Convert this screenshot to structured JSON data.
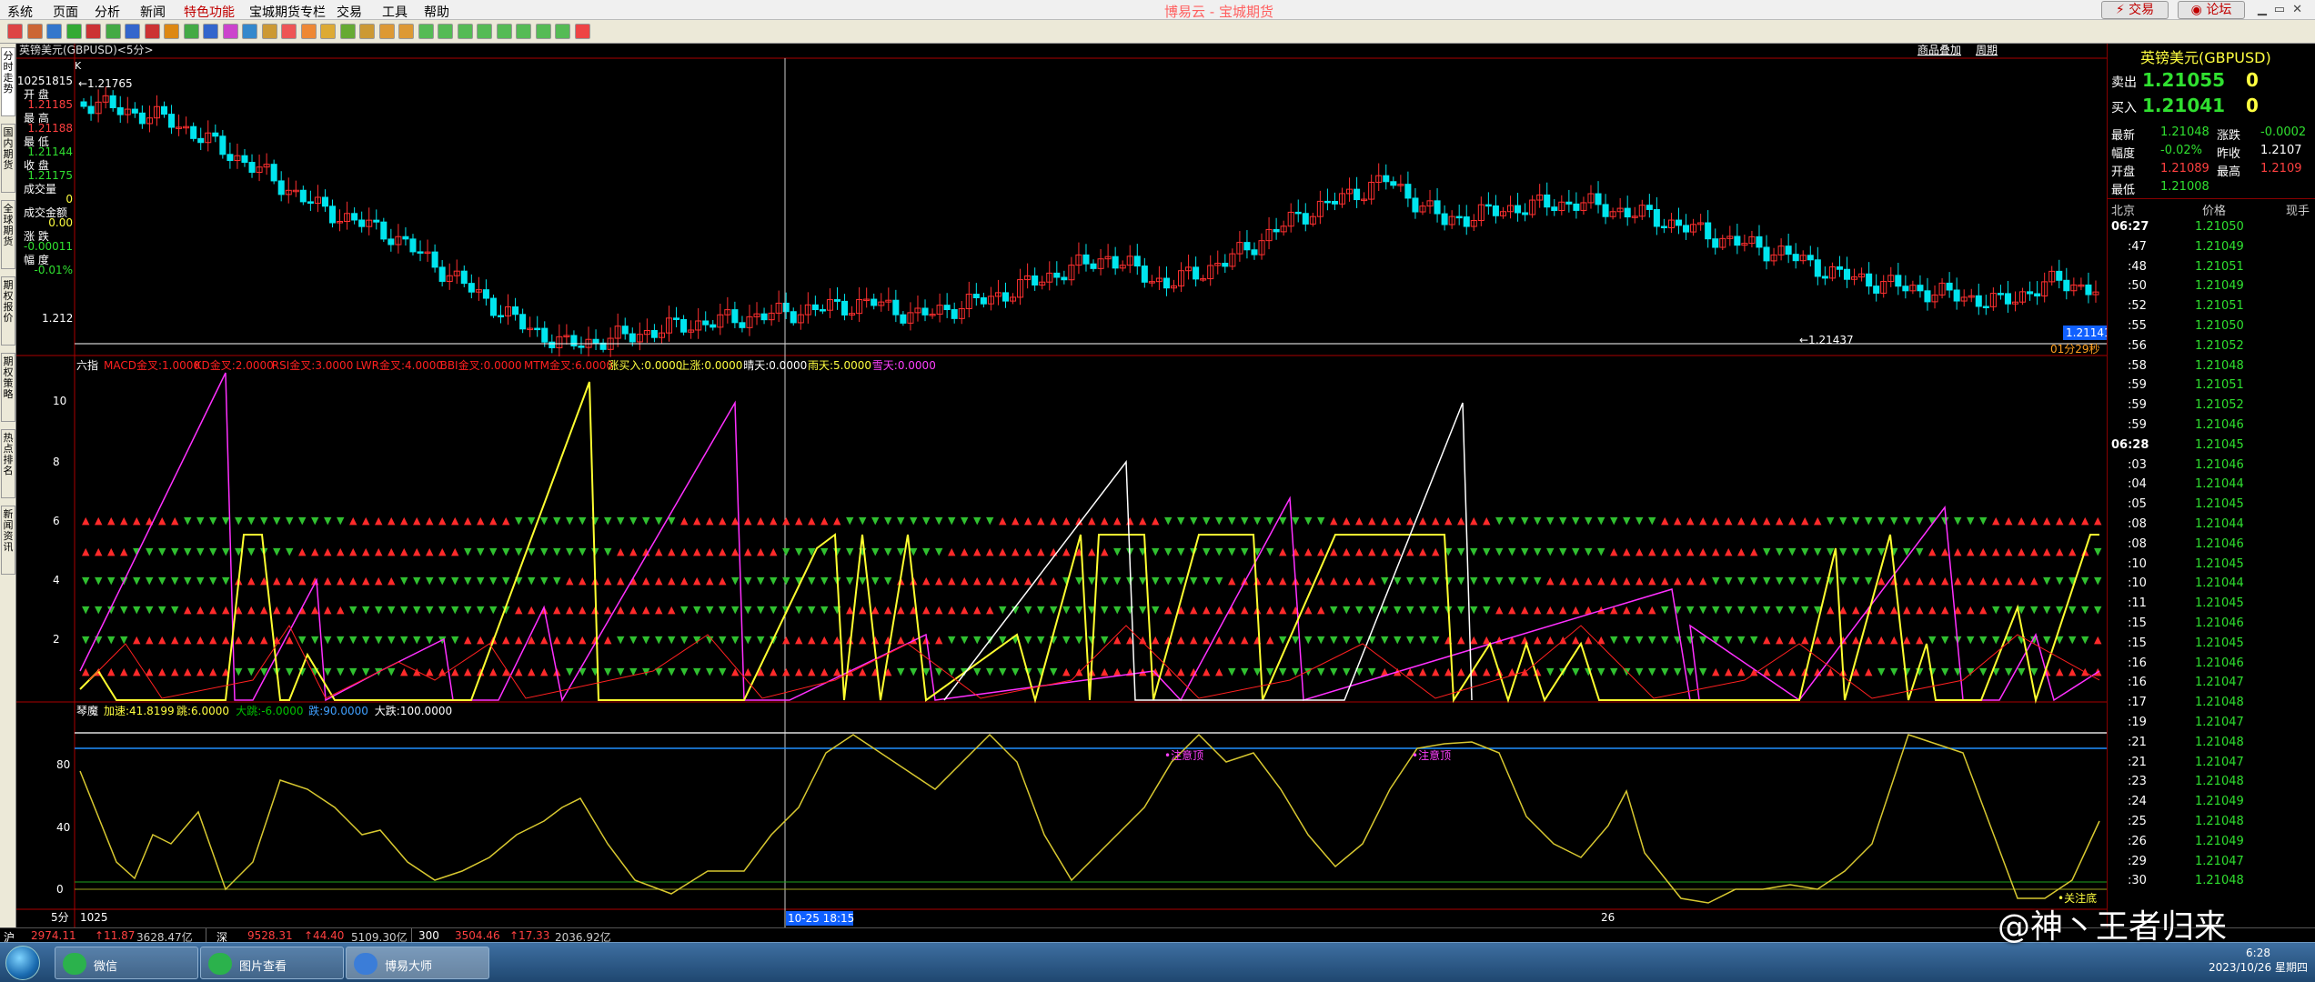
{
  "menu": {
    "items": [
      "系统",
      "页面",
      "分析",
      "新闻",
      "特色功能",
      "宝城期货专栏",
      "交易",
      "工具",
      "帮助"
    ],
    "highlight_index": 4,
    "title": "博易云 - 宝城期货",
    "trade_btn": "交易",
    "forum_btn": "论坛"
  },
  "side_tabs": [
    "分时走势",
    "国内期货",
    "全球期货",
    "期权报价",
    "期权策略",
    "热点排名",
    "新闻资讯"
  ],
  "chart_header": {
    "symbol": "英镑美元(GBPUSD)<5分>",
    "buttons": [
      "商品叠加",
      "周期"
    ],
    "top_price": "1.21765",
    "bottom_price": "1.21437",
    "price_scale": "1.212",
    "last_price": "1.21141",
    "countdown": "01分29秒",
    "k_label": "K"
  },
  "info_panel": {
    "date": "10251815",
    "open_label": "开  盘",
    "open": "1.21185",
    "high_label": "最  高",
    "high": "1.21188",
    "low_label": "最  低",
    "low": "1.21144",
    "close_label": "收  盘",
    "close": "1.21175",
    "vol_label": "成交量",
    "vol": "0",
    "amt_label": "成交金额",
    "amt": "0.00",
    "chg_label": "涨  跌",
    "chg": "-0.00011",
    "pct_label": "幅  度",
    "pct": "-0.01%"
  },
  "indicator1": {
    "name": "六指",
    "params": [
      {
        "text": "MACD金叉:1.0000",
        "color": "#ff2020"
      },
      {
        "text": "KD金叉:2.0000",
        "color": "#ff2020"
      },
      {
        "text": "RSI金叉:3.0000",
        "color": "#ff2020"
      },
      {
        "text": "LWR金叉:4.0000",
        "color": "#ff2020"
      },
      {
        "text": "BBI金叉:0.0000",
        "color": "#ff2020"
      },
      {
        "text": "MTM金叉:6.0000",
        "color": "#ff2020"
      },
      {
        "text": "涨买入:0.0000",
        "color": "#ffff40"
      },
      {
        "text": "上涨:0.0000",
        "color": "#ffff40"
      },
      {
        "text": "晴天:0.0000",
        "color": "#ffffff"
      },
      {
        "text": "雨天:5.0000",
        "color": "#ffff40"
      },
      {
        "text": "雪天:0.0000",
        "color": "#ff40ff"
      }
    ],
    "y_ticks": [
      "10",
      "8",
      "6",
      "4",
      "2"
    ]
  },
  "indicator2": {
    "name": "琴魔",
    "params": [
      {
        "text": "加速:41.8199",
        "color": "#ffff40"
      },
      {
        "text": "跳:6.0000",
        "color": "#ffff40"
      },
      {
        "text": "大跳:-6.0000",
        "color": "#00c000"
      },
      {
        "text": "跌:90.0000",
        "color": "#40a0ff"
      },
      {
        "text": "大跌:100.0000",
        "color": "#ffffff"
      }
    ],
    "y_ticks": [
      "80",
      "40",
      "0"
    ],
    "notes": [
      "注意顶",
      "注意顶",
      "关注底"
    ]
  },
  "x_axis": {
    "period": "5分",
    "start": "1025",
    "cursor": "10-25 18:15",
    "mid": "26"
  },
  "quote": {
    "title": "英镑美元(GBPUSD)",
    "sell_label": "卖出",
    "sell": "1.21055",
    "sell_vol": "0",
    "buy_label": "买入",
    "buy": "1.21041",
    "buy_vol": "0",
    "rows": [
      [
        "最新",
        "1.21048",
        "涨跌",
        "-0.0002"
      ],
      [
        "幅度",
        "-0.02%",
        "昨收",
        "1.2107"
      ],
      [
        "开盘",
        "1.21089",
        "最高",
        "1.2109"
      ],
      [
        "最低",
        "1.21008",
        "",
        ""
      ]
    ],
    "tick_header": [
      "北京",
      "价格",
      "现手"
    ],
    "ticks": [
      [
        "06:27",
        "1.21050"
      ],
      [
        ":47",
        "1.21049"
      ],
      [
        ":48",
        "1.21051"
      ],
      [
        ":50",
        "1.21049"
      ],
      [
        ":52",
        "1.21051"
      ],
      [
        ":55",
        "1.21050"
      ],
      [
        ":56",
        "1.21052"
      ],
      [
        ":58",
        "1.21048"
      ],
      [
        ":59",
        "1.21051"
      ],
      [
        ":59",
        "1.21052"
      ],
      [
        ":59",
        "1.21046"
      ],
      [
        "06:28",
        "1.21045"
      ],
      [
        ":03",
        "1.21046"
      ],
      [
        ":04",
        "1.21044"
      ],
      [
        ":05",
        "1.21045"
      ],
      [
        ":08",
        "1.21044"
      ],
      [
        ":08",
        "1.21046"
      ],
      [
        ":10",
        "1.21045"
      ],
      [
        ":10",
        "1.21044"
      ],
      [
        ":11",
        "1.21045"
      ],
      [
        ":15",
        "1.21046"
      ],
      [
        ":15",
        "1.21045"
      ],
      [
        ":16",
        "1.21046"
      ],
      [
        ":16",
        "1.21047"
      ],
      [
        ":17",
        "1.21048"
      ],
      [
        ":19",
        "1.21047"
      ],
      [
        ":21",
        "1.21048"
      ],
      [
        ":21",
        "1.21047"
      ],
      [
        ":23",
        "1.21048"
      ],
      [
        ":24",
        "1.21049"
      ],
      [
        ":25",
        "1.21048"
      ],
      [
        ":26",
        "1.21049"
      ],
      [
        ":29",
        "1.21047"
      ],
      [
        ":30",
        "1.21048"
      ]
    ]
  },
  "status": {
    "items": [
      {
        "t": "沪",
        "c": "#fff"
      },
      {
        "t": "2974.11",
        "c": "#ff4040"
      },
      {
        "t": "↑11.87",
        "c": "#ff4040"
      },
      {
        "t": "3628.47亿",
        "c": "#ccc"
      },
      {
        "t": "深",
        "c": "#fff"
      },
      {
        "t": "9528.31",
        "c": "#ff4040"
      },
      {
        "t": "↑44.40",
        "c": "#ff4040"
      },
      {
        "t": "5109.30亿",
        "c": "#ccc"
      },
      {
        "t": "300",
        "c": "#fff"
      },
      {
        "t": "3504.46",
        "c": "#ff4040"
      },
      {
        "t": "↑17.33",
        "c": "#ff4040"
      },
      {
        "t": "2036.92亿",
        "c": "#ccc"
      }
    ]
  },
  "taskbar": {
    "tasks": [
      "微信",
      "图片查看",
      "博易大师"
    ],
    "time": "6:28",
    "date": "2023/10/26 星期四",
    "watermark": "@神丶王者归来"
  }
}
